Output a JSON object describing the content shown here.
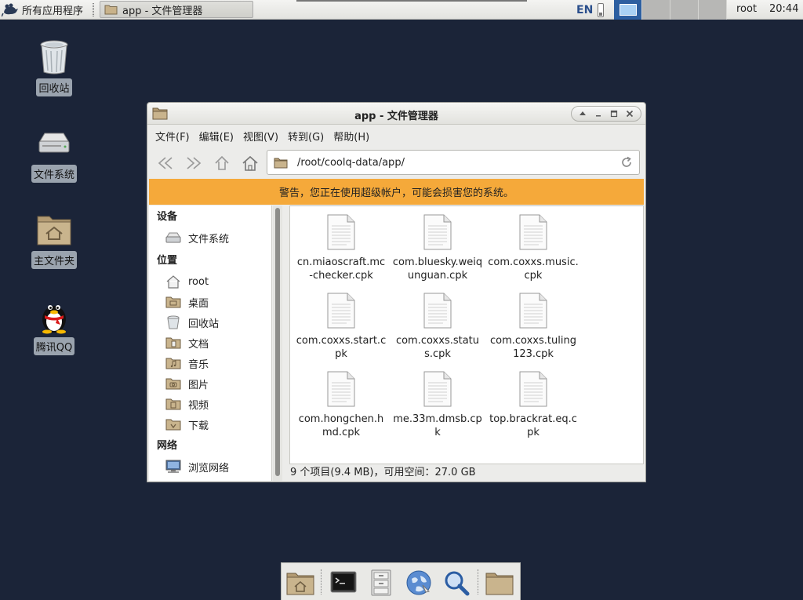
{
  "top_panel": {
    "apps_menu_label": "所有应用程序",
    "task_button_label": "app - 文件管理器",
    "language": "EN",
    "user": "root",
    "time": "20:44"
  },
  "desktop": {
    "icons": [
      {
        "label": "回收站",
        "icon": "trash-icon"
      },
      {
        "label": "文件系统",
        "icon": "drive-icon"
      },
      {
        "label": "主文件夹",
        "icon": "home-folder-icon"
      },
      {
        "label": "腾讯QQ",
        "icon": "qq-penguin-icon"
      }
    ]
  },
  "window": {
    "title": "app - 文件管理器",
    "menu": [
      "文件(F)",
      "编辑(E)",
      "视图(V)",
      "转到(G)",
      "帮助(H)"
    ],
    "location": "/root/coolq-data/app/",
    "warning": "警告，您正在使用超级帐户，可能会损害您的系统。",
    "sidebar": {
      "devices_header": "设备",
      "devices": [
        {
          "label": "文件系统",
          "icon": "drive-icon"
        }
      ],
      "places_header": "位置",
      "places": [
        {
          "label": "root",
          "icon": "home-icon"
        },
        {
          "label": "桌面",
          "icon": "desktop-folder-icon"
        },
        {
          "label": "回收站",
          "icon": "trash-icon"
        },
        {
          "label": "文档",
          "icon": "documents-folder-icon"
        },
        {
          "label": "音乐",
          "icon": "music-folder-icon"
        },
        {
          "label": "图片",
          "icon": "pictures-folder-icon"
        },
        {
          "label": "视频",
          "icon": "videos-folder-icon"
        },
        {
          "label": "下载",
          "icon": "downloads-folder-icon"
        }
      ],
      "network_header": "网络",
      "network": [
        {
          "label": "浏览网络",
          "icon": "network-icon"
        }
      ]
    },
    "files": [
      {
        "name": "cn.miaoscraft.mc-checker.cpk"
      },
      {
        "name": "com.bluesky.weiqunguan.cpk"
      },
      {
        "name": "com.coxxs.music.cpk"
      },
      {
        "name": "com.coxxs.start.cpk"
      },
      {
        "name": "com.coxxs.status.cpk"
      },
      {
        "name": "com.coxxs.tuling123.cpk"
      },
      {
        "name": "com.hongchen.hmd.cpk"
      },
      {
        "name": "me.33m.dmsb.cpk"
      },
      {
        "name": "top.brackrat.eq.cpk"
      }
    ],
    "status": "9 个项目(9.4 MB)，可用空间：27.0 GB"
  },
  "dock": {
    "items": [
      "home-folder-icon",
      "terminal-icon",
      "file-cabinet-icon",
      "web-browser-icon",
      "search-icon",
      "folder-icon"
    ]
  },
  "colors": {
    "desktop_bg": "#1b2438",
    "warning_bg": "#f5a93a",
    "workspace_active": "#2d5fa0"
  }
}
